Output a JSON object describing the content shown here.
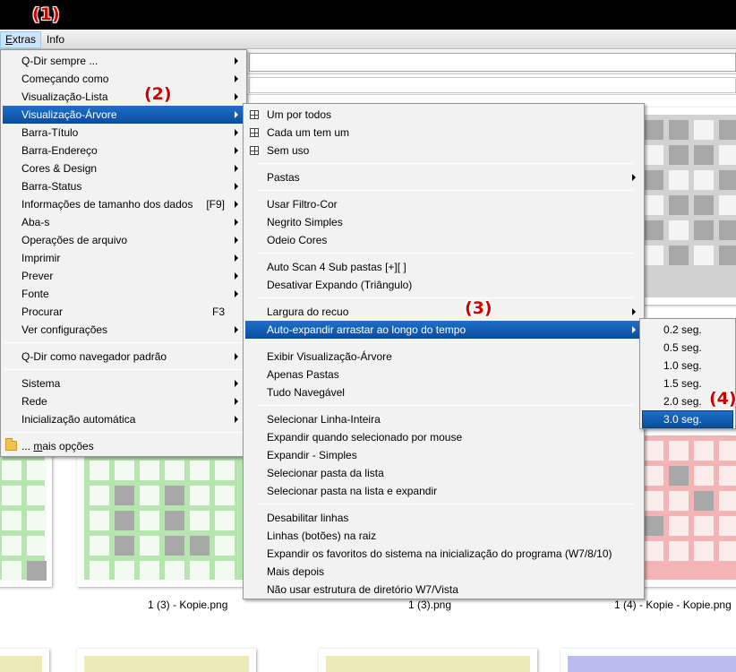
{
  "menubar": {
    "items": [
      {
        "label": "Extras",
        "mnemonic": "E",
        "rest": "xtras"
      },
      {
        "label": "Info"
      }
    ]
  },
  "main_menu": {
    "items": [
      {
        "label": "Q-Dir sempre ..."
      },
      {
        "label": "Começando como"
      },
      {
        "label": "Visualização-Lista"
      },
      {
        "label": "Visualização-Árvore"
      },
      {
        "label": "Barra-Título"
      },
      {
        "label": "Barra-Endereço"
      },
      {
        "label": "Cores & Design"
      },
      {
        "label": "Barra-Status"
      },
      {
        "label": "Informações de tamanho dos dados",
        "shortcut": "[F9]"
      },
      {
        "label": "Aba-s"
      },
      {
        "label": "Operações de arquivo"
      },
      {
        "label": "Imprimir"
      },
      {
        "label": "Prever"
      },
      {
        "label": "Fonte"
      },
      {
        "label": "Procurar",
        "shortcut": "F3"
      },
      {
        "label": "Ver configurações"
      },
      {
        "label": "Q-Dir como navegador padrão"
      },
      {
        "label": "Sistema"
      },
      {
        "label": "Rede"
      },
      {
        "label": "Inicialização automática"
      },
      {
        "label": "... mais opções",
        "prefix": "... ",
        "mnemonic": "m",
        "rest": "ais opções"
      }
    ]
  },
  "tree_menu": {
    "items": [
      {
        "label": "Um por todos"
      },
      {
        "label": "Cada um tem um"
      },
      {
        "label": "Sem uso"
      },
      {
        "label": "Pastas"
      },
      {
        "label": "Usar Filtro-Cor"
      },
      {
        "label": "Negrito Simples"
      },
      {
        "label": "Odeio Cores"
      },
      {
        "label": "Auto Scan 4 Sub pastas [+][ ]"
      },
      {
        "label": "Desativar Expando (Triângulo)"
      },
      {
        "label": "Largura do recuo"
      },
      {
        "label": "Auto-expandir arrastar ao longo do tempo"
      },
      {
        "label": "Exibir Visualização-Árvore"
      },
      {
        "label": "Apenas Pastas"
      },
      {
        "label": "Tudo Navegável"
      },
      {
        "label": "Selecionar Linha-Inteira"
      },
      {
        "label": "Expandir quando selecionado por mouse"
      },
      {
        "label": "Expandir - Simples"
      },
      {
        "label": "Selecionar pasta da lista"
      },
      {
        "label": "Selecionar pasta na lista e expandir"
      },
      {
        "label": "Desabilitar linhas"
      },
      {
        "label": "Linhas (botões) na raiz"
      },
      {
        "label": "Expandir os favoritos do sistema na inicialização do programa (W7/8/10)"
      },
      {
        "label": "Mais depois"
      },
      {
        "label": "Não usar estrutura de diretório W7/Vista"
      }
    ]
  },
  "time_menu": {
    "items": [
      {
        "label": "0.2 seg."
      },
      {
        "label": "0.5 seg."
      },
      {
        "label": "1.0 seg."
      },
      {
        "label": "1.5 seg."
      },
      {
        "label": "2.0 seg."
      },
      {
        "label": "3.0 seg."
      }
    ]
  },
  "captions": [
    "1 (3) - Kopie.png",
    "1 (3).png",
    "1 (4) - Kopie - Kopie.png"
  ],
  "annotations": [
    "(1)",
    "(2)",
    "(3)",
    "(4)"
  ],
  "colors": {
    "highlight": "#0a4d9c",
    "annotation": "#d00000",
    "thumb_green": "#b6e5b0",
    "thumb_gray": "#d2d2d2",
    "thumb_red": "#f2b4b4",
    "thumb_yellow": "#eeeab8",
    "thumb_blue": "#b9bcec"
  }
}
